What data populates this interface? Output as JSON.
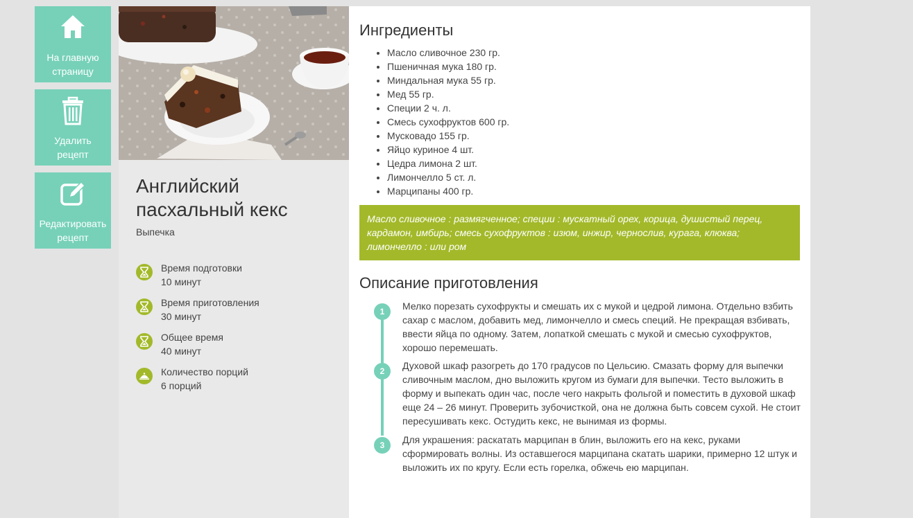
{
  "nav": {
    "home_label": "На главную страницу",
    "delete_label": "Удалить рецепт",
    "edit_label": "Редактировать рецепт"
  },
  "recipe": {
    "title": "Английский пасхальный кекс",
    "category": "Выпечка",
    "info": [
      {
        "label": "Время подготовки",
        "value": "10 минут",
        "icon": "hourglass-icon"
      },
      {
        "label": "Время приготовления",
        "value": "30 минут",
        "icon": "hourglass-icon"
      },
      {
        "label": "Общее время",
        "value": "40 минут",
        "icon": "hourglass-icon"
      },
      {
        "label": "Количество порций",
        "value": "6 порций",
        "icon": "dish-icon"
      }
    ]
  },
  "ingredients": {
    "heading": "Ингредиенты",
    "items": [
      "Масло сливочное 230 гр.",
      "Пшеничная мука 180 гр.",
      "Миндальная мука 55 гр.",
      "Мед 55 гр.",
      "Специи 2 ч. л.",
      "Смесь сухофруктов 600 гр.",
      "Мусковадо 155 гр.",
      "Яйцо куриное 4 шт.",
      "Цедра лимона 2 шт.",
      "Лимончелло 5 ст. л.",
      "Марципаны 400 гр."
    ],
    "note": "Масло сливочное : размягченное; специи : мускатный орех, корица, душистый перец, кардамон, имбирь; смесь сухофруктов : изюм, инжир, чернослив, курага, клюква; лимончелло : или ром"
  },
  "steps": {
    "heading": "Описание приготовления",
    "items": [
      {
        "num": "1",
        "text": "Мелко порезать сухофрукты и смешать их с мукой и цедрой лимона. Отдельно взбить сахар с маслом, добавить мед, лимончелло и смесь специй. Не прекращая взбивать, ввести яйца по одному. Затем, лопаткой смешать с мукой и смесью сухофруктов, хорошо перемешать."
      },
      {
        "num": "2",
        "text": "Духовой шкаф разогреть до 170 градусов по Цельсию. Смазать форму для выпечки сливочным маслом, дно выложить кругом из бумаги для выпечки. Тесто выложить в форму и выпекать один час, после чего накрыть фольгой и поместить в духовой шкаф еще 24 – 26 минут. Проверить зубочисткой, она не должна быть совсем сухой. Не стоит пересушивать кекс. Остудить кекс, не вынимая из формы."
      },
      {
        "num": "3",
        "text": "Для украшения: раскатать марципан в блин, выложить его на кекс, руками сформировать волны. Из оставшегося марципана скатать шарики, примерно 12 штук и выложить их по кругу. Если есть горелка, обжечь ею марципан."
      }
    ]
  },
  "colors": {
    "accent_teal": "#76d1b8",
    "accent_green": "#a3b92a"
  }
}
